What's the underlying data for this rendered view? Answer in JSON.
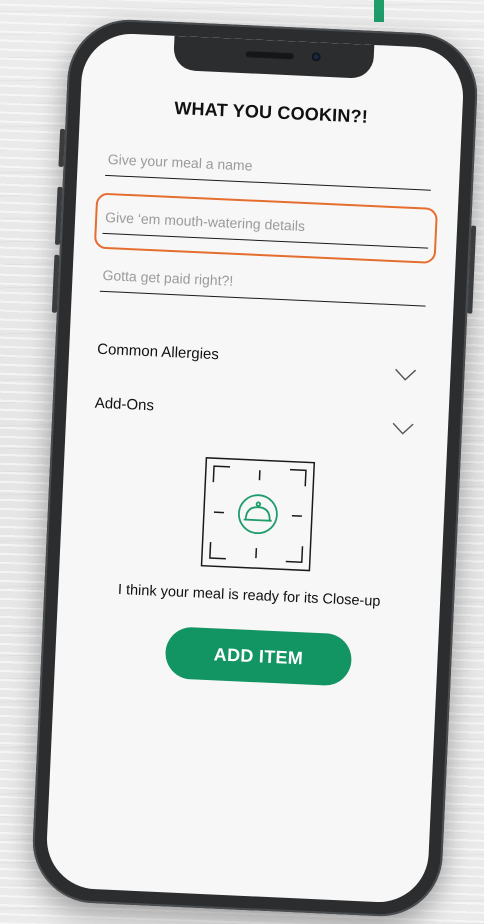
{
  "form": {
    "title": "WHAT YOU COOKIN?!",
    "fields": {
      "name": {
        "placeholder": "Give your meal a name",
        "value": ""
      },
      "description": {
        "placeholder": "Give ‘em mouth-watering details",
        "value": ""
      },
      "price": {
        "placeholder": "Gotta get paid right?!",
        "value": ""
      }
    },
    "dropdowns": {
      "allergies": {
        "label": "Common Allergies",
        "icon": "chevron-down-icon"
      },
      "addons": {
        "label": "Add-Ons",
        "icon": "chevron-down-icon"
      }
    },
    "photo": {
      "icon": "food-cloche-icon",
      "caption": "I think your meal is ready for its Close-up"
    },
    "submit_label": "ADD ITEM"
  },
  "colors": {
    "accent": "#139463",
    "highlight": "#e56e2e",
    "icon_stroke": "#1f9d6b",
    "screen_bg": "#f7f7f7",
    "phone_body": "#2b2d2f"
  }
}
